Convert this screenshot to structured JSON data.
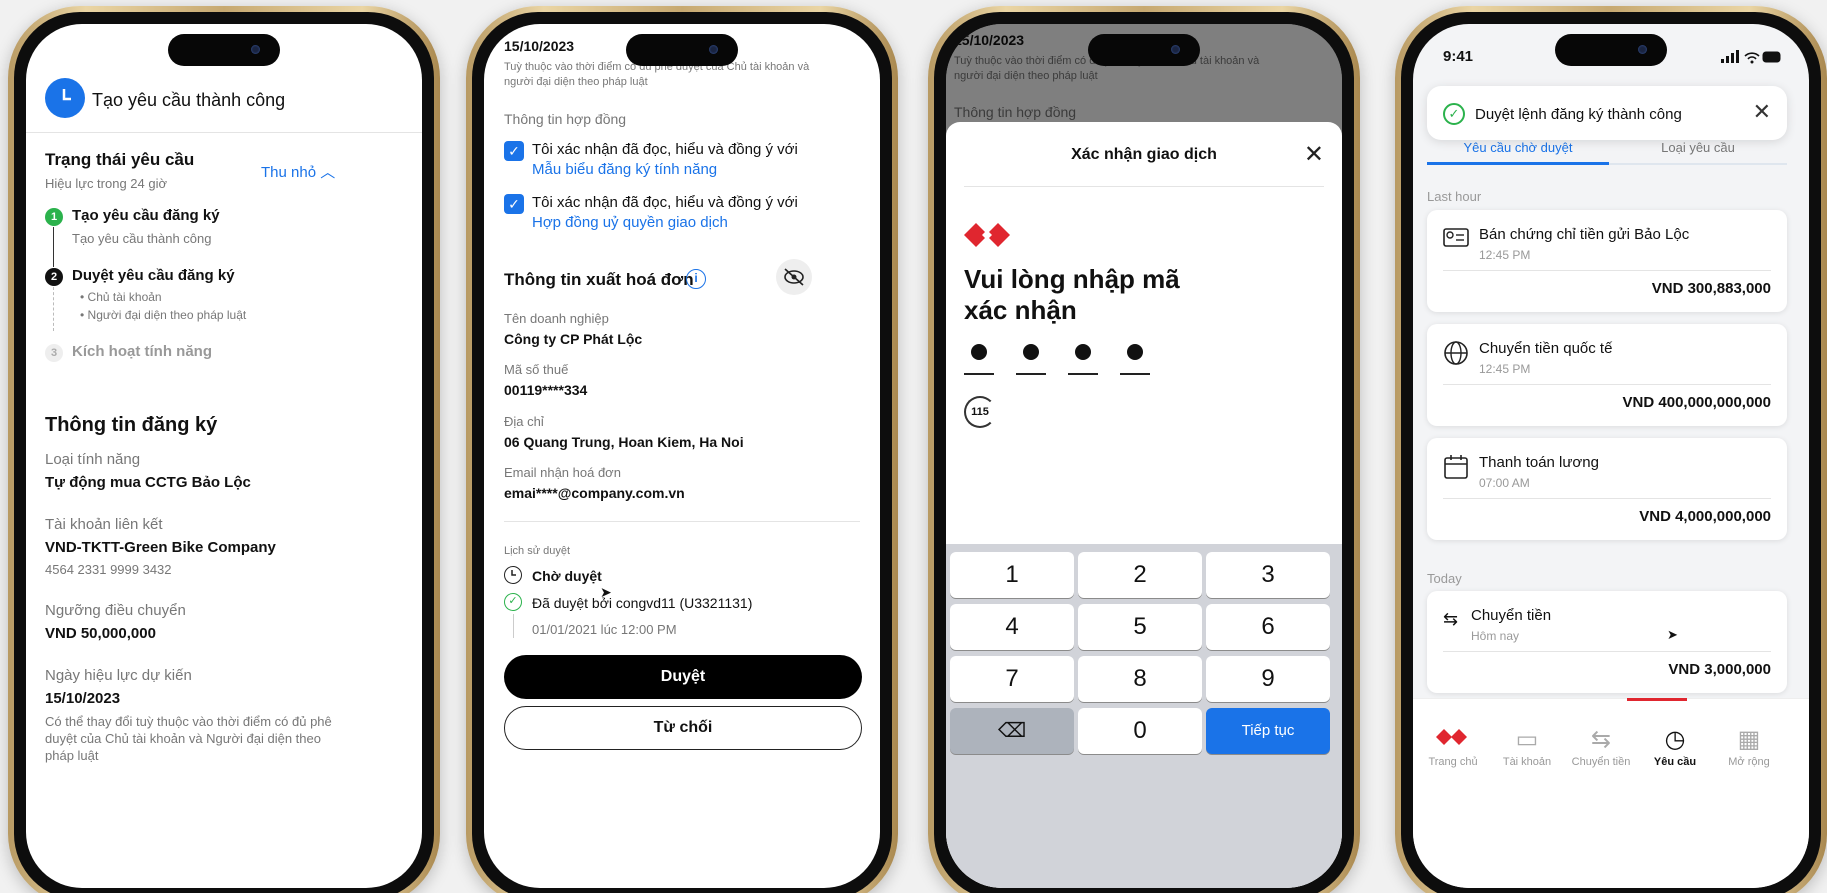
{
  "screen1": {
    "header_title": "Tạo yêu cầu thành công",
    "status_title": "Trạng thái yêu cầu",
    "status_validity": "Hiệu lực trong 24 giờ",
    "collapse_label": "Thu nhỏ",
    "steps": [
      {
        "num": "1",
        "title": "Tạo yêu cầu đăng ký",
        "desc": "Tạo yêu cầu thành công"
      },
      {
        "num": "2",
        "title": "Duyệt yêu cầu đăng ký",
        "sub": [
          "Chủ tài khoản",
          "Người đại diện theo pháp luật"
        ]
      },
      {
        "num": "3",
        "title": "Kích hoạt tính năng"
      }
    ],
    "reg_title": "Thông tin đăng ký",
    "feature_label": "Loại tính năng",
    "feature_value": "Tự động mua CCTG Bảo Lộc",
    "account_label": "Tài khoản liên kết",
    "account_value": "VND-TKTT-Green Bike Company",
    "account_number": "4564 2331 9999 3432",
    "threshold_label": "Ngưỡng điều chuyển",
    "threshold_value": "VND 50,000,000",
    "effective_label": "Ngày hiệu lực dự kiến",
    "effective_value": "15/10/2023",
    "note": "Có thể thay đổi tuỳ thuộc vào thời điểm có đủ phê duyệt của Chủ tài khoản và Người đại diện theo pháp luật"
  },
  "screen2": {
    "date": "15/10/2023",
    "note": "Tuỳ thuộc vào thời điểm có đủ phê duyệt của Chủ tài khoản và người đại diện theo pháp luật",
    "contract_label": "Thông tin hợp đồng",
    "confirm_text": "Tôi xác nhận đã đọc, hiểu và đồng ý với",
    "link1": "Mẫu biểu đăng ký tính năng",
    "link2": "Hợp đồng uỷ quyền giao dịch",
    "invoice_title": "Thông tin xuất hoá đơn",
    "company_label": "Tên doanh nghiệp",
    "company_value": "Công ty CP Phát Lộc",
    "tax_label": "Mã số thuế",
    "tax_value": "00119****334",
    "address_label": "Địa chỉ",
    "address_value": "06 Quang Trung, Hoan Kiem, Ha Noi",
    "email_label": "Email nhận hoá đơn",
    "email_value": "emai****@company.com.vn",
    "history_label": "Lịch sử duyệt",
    "pending": "Chờ duyệt",
    "approved": "Đã duyệt bởi congvd11 (U3321131)",
    "approved_time": "01/01/2021 lúc 12:00 PM",
    "approve_btn": "Duyệt",
    "reject_btn": "Từ chối"
  },
  "screen3": {
    "bg_date": "15/10/2023",
    "bg_note": "Tuỳ thuộc vào thời điểm có đủ phê duyệt của Chủ tài khoản và người đại diện theo pháp luật",
    "bg_contract": "Thông tin hợp đồng",
    "sheet_title": "Xác nhận giao dịch",
    "prompt": "Vui lòng nhập mã xác nhận",
    "timer": "115",
    "keys": [
      "1",
      "2",
      "3",
      "4",
      "5",
      "6",
      "7",
      "8",
      "9",
      "0"
    ],
    "continue_btn": "Tiếp tục"
  },
  "screen4": {
    "time": "9:41",
    "toast": "Duyệt lệnh đăng ký thành công",
    "tabs": [
      "Yêu cầu chờ duyệt",
      "Loại yêu cầu"
    ],
    "section1": "Last hour",
    "section2": "Today",
    "cards": [
      {
        "title": "Bán chứng chỉ tiền gửi Bảo Lộc",
        "time": "12:45 PM",
        "amount": "VND 300,883,000",
        "icon": "certificate-icon"
      },
      {
        "title": "Chuyển tiền quốc tế",
        "time": "12:45 PM",
        "amount": "VND 400,000,000,000",
        "icon": "globe-icon"
      },
      {
        "title": "Thanh toán lương",
        "time": "07:00 AM",
        "amount": "VND 4,000,000,000",
        "icon": "calendar-icon"
      },
      {
        "title": "Chuyển tiền",
        "time": "Hôm nay",
        "amount": "VND 3,000,000",
        "icon": "transfer-icon"
      }
    ],
    "nav": [
      "Trang chủ",
      "Tài khoản",
      "Chuyển tiền",
      "Yêu cầu",
      "Mở rộng"
    ]
  },
  "colors": {
    "accent": "#1a73e8",
    "brand_red": "#e0262f",
    "success": "#2bb24c"
  }
}
